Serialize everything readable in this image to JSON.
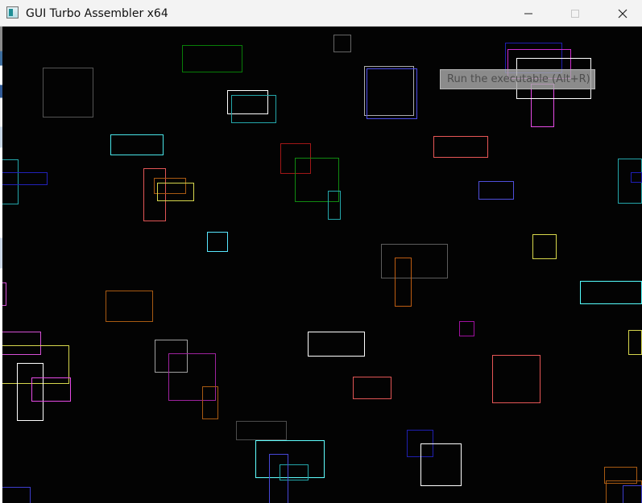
{
  "window": {
    "title": "GUI Turbo Assembler x64",
    "icons": {
      "app": "app-window-icon",
      "minimize": "minimize-icon",
      "maximize": "maximize-icon",
      "close": "close-icon"
    }
  },
  "canvas": {
    "background": "#030303",
    "tooltip": "Run the executable (Alt+R)"
  },
  "shapes": [
    {
      "name": "rectangle-01",
      "color": "#087e08"
    },
    {
      "name": "rectangle-02",
      "color": "#666666"
    },
    {
      "name": "rectangle-03",
      "color": "#555555"
    },
    {
      "name": "rectangle-04",
      "color": "#ffffff"
    },
    {
      "name": "rectangle-05",
      "color": "#24a6aa"
    },
    {
      "name": "rectangle-06",
      "color": "#acacac"
    },
    {
      "name": "rectangle-07",
      "color": "#4e4ee8"
    },
    {
      "name": "rectangle-08",
      "color": "#1f1fb0"
    },
    {
      "name": "rectangle-09",
      "color": "#ce2cce"
    },
    {
      "name": "rectangle-10",
      "color": "#e64be6"
    },
    {
      "name": "rectangle-11",
      "color": "#ffffff"
    },
    {
      "name": "rectangle-12",
      "color": "#48e4e8"
    },
    {
      "name": "rectangle-13",
      "color": "#e65656"
    },
    {
      "name": "rectangle-14",
      "color": "#a11717"
    },
    {
      "name": "rectangle-15",
      "color": "#118911"
    },
    {
      "name": "rectangle-16",
      "color": "#24a6aa"
    },
    {
      "name": "rectangle-17",
      "color": "#24a6aa"
    },
    {
      "name": "rectangle-18",
      "color": "#2222bb"
    },
    {
      "name": "rectangle-19",
      "color": "#e15555"
    },
    {
      "name": "rectangle-20",
      "color": "#a85a12"
    },
    {
      "name": "rectangle-21",
      "color": "#d6d64d"
    },
    {
      "name": "rectangle-22",
      "color": "#58e7ff"
    },
    {
      "name": "rectangle-23",
      "color": "#5050dc"
    },
    {
      "name": "rectangle-24",
      "color": "#24a6aa"
    },
    {
      "name": "rectangle-25",
      "color": "#1e1eb8"
    },
    {
      "name": "rectangle-26",
      "color": "#d8d84b"
    },
    {
      "name": "rectangle-27",
      "color": "#55ffff"
    },
    {
      "name": "rectangle-28",
      "color": "#5d5d5d"
    },
    {
      "name": "rectangle-29",
      "color": "#bd5d12"
    },
    {
      "name": "rectangle-30",
      "color": "#a85a12"
    },
    {
      "name": "rectangle-31",
      "color": "#d64fd6"
    },
    {
      "name": "rectangle-32",
      "color": "#d64fd6"
    },
    {
      "name": "rectangle-33",
      "color": "#d6d64d"
    },
    {
      "name": "rectangle-34",
      "color": "#ffffff"
    },
    {
      "name": "rectangle-35",
      "color": "#a010a0"
    },
    {
      "name": "rectangle-36",
      "color": "#d6d64d"
    },
    {
      "name": "rectangle-37",
      "color": "#e15555"
    },
    {
      "name": "rectangle-38",
      "color": "#ffffff"
    },
    {
      "name": "rectangle-39",
      "color": "#e64be6"
    },
    {
      "name": "rectangle-40",
      "color": "#a0a0a0"
    },
    {
      "name": "rectangle-41",
      "color": "#9e239e"
    },
    {
      "name": "rectangle-42",
      "color": "#a85a12"
    },
    {
      "name": "rectangle-43",
      "color": "#e65656"
    },
    {
      "name": "rectangle-44",
      "color": "#a85a12"
    },
    {
      "name": "rectangle-45",
      "color": "#4d4d4d"
    },
    {
      "name": "rectangle-46",
      "color": "#1f1fb0"
    },
    {
      "name": "rectangle-47",
      "color": "#ffffff"
    },
    {
      "name": "rectangle-48",
      "color": "#5fffff"
    },
    {
      "name": "rectangle-49",
      "color": "#24a6aa"
    },
    {
      "name": "rectangle-50",
      "color": "#4747d8"
    },
    {
      "name": "rectangle-51",
      "color": "#3d3dcc"
    },
    {
      "name": "rectangle-52",
      "color": "#a85a12"
    },
    {
      "name": "rectangle-53",
      "color": "#3d3dcc"
    }
  ]
}
